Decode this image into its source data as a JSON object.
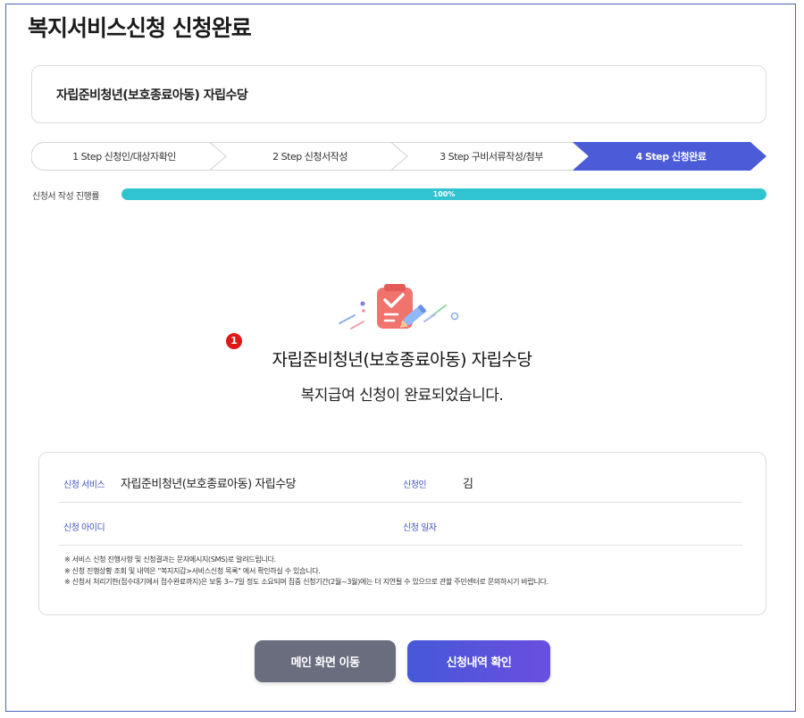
{
  "page": {
    "title": "복지서비스신청 신청완료"
  },
  "service": {
    "name": "자립준비청년(보호종료아동) 자립수당"
  },
  "steps": [
    {
      "label": "1 Step 신청인/대상자확인",
      "active": false
    },
    {
      "label": "2 Step 신청서작성",
      "active": false
    },
    {
      "label": "3 Step 구비서류작성/첨부",
      "active": false
    },
    {
      "label": "4 Step 신청완료",
      "active": true
    }
  ],
  "progress": {
    "label": "신청서 작성 진행률",
    "value_text": "100%",
    "value": 100
  },
  "completion": {
    "badge": "1",
    "service_name": "자립준비청년(보호종료아동) 자립수당",
    "message": "복지급여 신청이 완료되었습니다."
  },
  "info": {
    "service_label": "신청 서비스",
    "service_value": "자립준비청년(보호종료아동) 자립수당",
    "applicant_label": "신청인",
    "applicant_value": "김",
    "id_label": "신청 아이디",
    "id_value": "",
    "date_label": "신청 일자",
    "date_value": ""
  },
  "notes": [
    "※ 서비스 신청 진행사항 및 신청결과는 문자메시지(SMS)로 알려드립니다.",
    "※ 신청 진행상황 조회 및 내역은 \"복지지갑>서비스신청 목록\" 에서 확인하실 수 있습니다.",
    "※ 신청서 처리기한(접수대기에서 접수완료까지)은 보통 3~7일 정도 소요되며 집중 신청기간(2월~3월)에는 더 지연될 수 있으므로 관할 주민센터로 문의하시기 바랍니다."
  ],
  "buttons": {
    "main": "메인 화면 이동",
    "history": "신청내역 확인"
  },
  "colors": {
    "active_step": "#4c5bd8",
    "progress_fill": "#2fc4cf",
    "label_blue": "#4255c0",
    "badge_red": "#e01818",
    "button_gray": "#6a6d7e",
    "button_blue": "#4658d8"
  },
  "icons": {
    "completion": "checklist-pen-icon"
  }
}
